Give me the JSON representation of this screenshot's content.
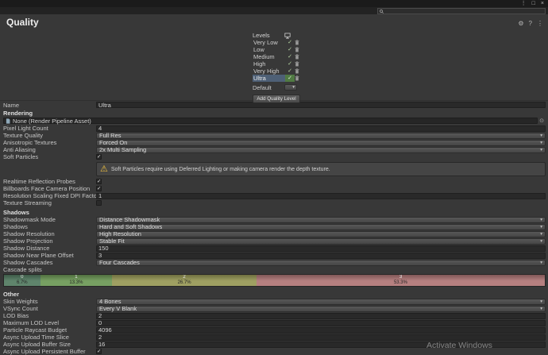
{
  "icons": {
    "check": "✓",
    "dropdown_arrow": "▾",
    "object_picker": "⊙",
    "warning": "⚠",
    "more": "⋮",
    "restore": "□",
    "close": "×",
    "preset": "⚙",
    "help": "?",
    "menu": "⋮"
  },
  "header": {
    "title": "Quality"
  },
  "search": {
    "value": ""
  },
  "levels": {
    "label": "Levels",
    "rows": [
      {
        "name": "Very Low",
        "checked": true
      },
      {
        "name": "Low",
        "checked": true
      },
      {
        "name": "Medium",
        "checked": true
      },
      {
        "name": "High",
        "checked": true
      },
      {
        "name": "Very High",
        "checked": true
      },
      {
        "name": "Ultra",
        "checked": true,
        "selected": true
      }
    ],
    "default_label": "Default",
    "add_button_label": "Add Quality Level"
  },
  "form": {
    "name_label": "Name",
    "name_value": "Ultra",
    "rendering": {
      "header": "Rendering",
      "pipeline_label": "None (Render Pipeline Asset)",
      "rows": [
        {
          "label": "Pixel Light Count",
          "value": "4",
          "type": "text"
        },
        {
          "label": "Texture Quality",
          "value": "Full Res",
          "type": "dropdown"
        },
        {
          "label": "Anisotropic Textures",
          "value": "Forced On",
          "type": "dropdown"
        },
        {
          "label": "Anti Aliasing",
          "value": "2x Multi Sampling",
          "type": "dropdown"
        },
        {
          "label": "Soft Particles",
          "type": "checkbox",
          "checked": true
        }
      ],
      "warning": "Soft Particles require using Deferred Lighting or making camera render the depth texture.",
      "rows2": [
        {
          "label": "Realtime Reflection Probes",
          "type": "checkbox",
          "checked": true
        },
        {
          "label": "Billboards Face Camera Position",
          "type": "checkbox",
          "checked": true
        },
        {
          "label": "Resolution Scaling Fixed DPI Factor",
          "value": "1",
          "type": "text"
        },
        {
          "label": "Texture Streaming",
          "type": "checkbox",
          "checked": false
        }
      ]
    },
    "shadows": {
      "header": "Shadows",
      "rows": [
        {
          "label": "Shadowmask Mode",
          "value": "Distance Shadowmask",
          "type": "dropdown"
        },
        {
          "label": "Shadows",
          "value": "Hard and Soft Shadows",
          "type": "dropdown"
        },
        {
          "label": "Shadow Resolution",
          "value": "High Resolution",
          "type": "dropdown"
        },
        {
          "label": "Shadow Projection",
          "value": "Stable Fit",
          "type": "dropdown"
        },
        {
          "label": "Shadow Distance",
          "value": "150",
          "type": "text"
        },
        {
          "label": "Shadow Near Plane Offset",
          "value": "3",
          "type": "text"
        },
        {
          "label": "Shadow Cascades",
          "value": "Four Cascades",
          "type": "dropdown"
        }
      ],
      "cascade_label": "Cascade splits",
      "cascades": [
        {
          "index": "0",
          "percent": "6.7%",
          "width": 6.7,
          "color": "#557d63"
        },
        {
          "index": "1",
          "percent": "13.3%",
          "width": 13.3,
          "color": "#6f9a58"
        },
        {
          "index": "2",
          "percent": "26.7%",
          "width": 26.7,
          "color": "#999a58"
        },
        {
          "index": "3",
          "percent": "53.3%",
          "width": 53.3,
          "color": "#b17878"
        }
      ]
    },
    "other": {
      "header": "Other",
      "rows": [
        {
          "label": "Skin Weights",
          "value": "4 Bones",
          "type": "dropdown"
        },
        {
          "label": "VSync Count",
          "value": "Every V Blank",
          "type": "dropdown"
        },
        {
          "label": "LOD Bias",
          "value": "2",
          "type": "text"
        },
        {
          "label": "Maximum LOD Level",
          "value": "0",
          "type": "text"
        },
        {
          "label": "Particle Raycast Budget",
          "value": "4096",
          "type": "text"
        },
        {
          "label": "Async Upload Time Slice",
          "value": "2",
          "type": "text"
        },
        {
          "label": "Async Upload Buffer Size",
          "value": "16",
          "type": "text"
        },
        {
          "label": "Async Upload Persistent Buffer",
          "type": "checkbox",
          "checked": true
        }
      ]
    }
  },
  "watermark": "Activate Windows"
}
